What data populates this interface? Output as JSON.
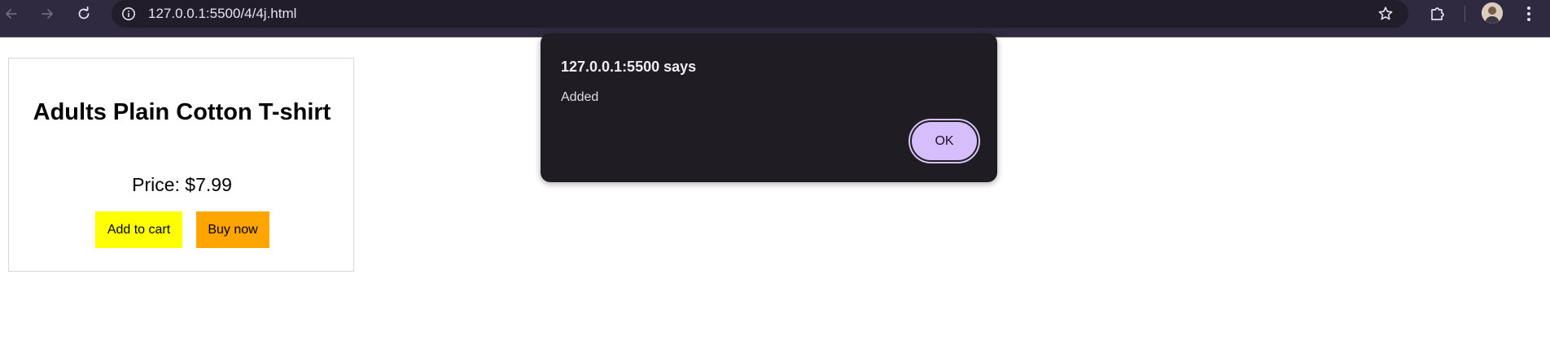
{
  "browser": {
    "url": "127.0.0.1:5500/4/4j.html",
    "icons": {
      "back": "arrow-left-icon",
      "forward": "arrow-right-icon",
      "reload": "reload-icon",
      "site_info": "info-icon",
      "bookmark": "star-icon",
      "extensions": "puzzle-icon",
      "profile": "avatar",
      "menu": "kebab-menu-icon"
    },
    "colors": {
      "toolbar": "#2f2a3f",
      "omnibox": "#211d2b"
    }
  },
  "product": {
    "title": "Adults Plain Cotton T-shirt",
    "price": "Price: $7.99",
    "add_to_cart_label": "Add to cart",
    "buy_now_label": "Buy now",
    "colors": {
      "add_to_cart": "#ffff00",
      "buy_now": "#ffa500"
    }
  },
  "alert": {
    "title": "127.0.0.1:5500 says",
    "message": "Added",
    "ok_label": "OK",
    "colors": {
      "background": "#1f1c23",
      "ok_button": "#d6bdfb"
    }
  }
}
